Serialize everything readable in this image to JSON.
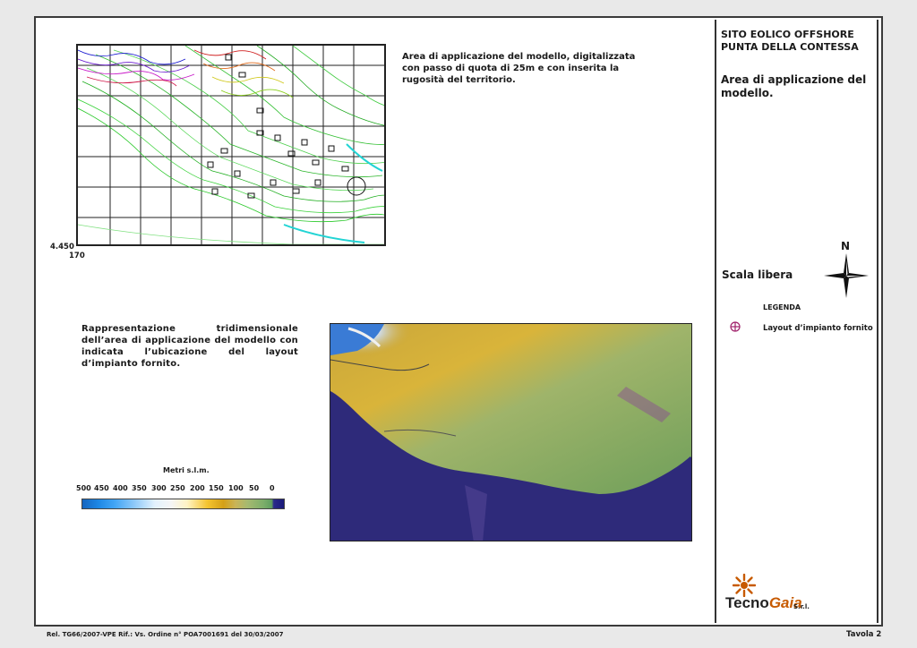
{
  "sidebar": {
    "title_line1": "SITO EOLICO OFFSHORE",
    "title_line2": "PUNTA DELLA CONTESSA",
    "subtitle_line1": "Area di applicazione del",
    "subtitle_line2": "modello.",
    "scale_label": "Scala libera",
    "north_label": "N",
    "legend_title": "LEGENDA",
    "legend_item": "Layout d’impianto fornito"
  },
  "map1": {
    "caption": "Area di applicazione del modello, digitalizzata con passo di quota di 25m e con inserita la rugosità del territorio.",
    "y_label": "4.450",
    "x_label": "170"
  },
  "map2": {
    "caption": "Rappresentazione tridimensionale dell’area di applicazione del modello con indicata l’ubicazione del layout d’impianto fornito."
  },
  "colorbar": {
    "title": "Metri s.l.m.",
    "ticks": [
      "500",
      "450",
      "400",
      "350",
      "300",
      "250",
      "200",
      "150",
      "100",
      "50",
      "0"
    ]
  },
  "footer": {
    "left": "Rel. TG66/2007-VPE Rif.: Vs. Ordine n° POA7001691 del 30/03/2007",
    "right": "Tavola 2"
  },
  "logo": {
    "text_a": "Tecno",
    "text_b": "Gaia",
    "suffix": "S.r.l."
  }
}
